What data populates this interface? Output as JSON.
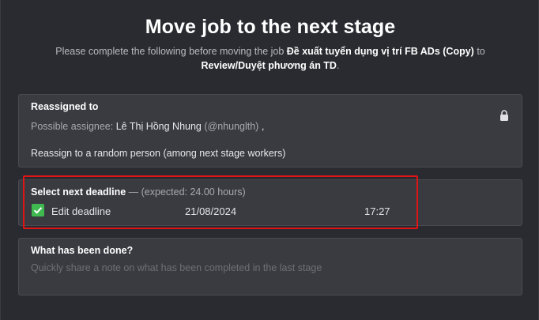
{
  "dialog": {
    "title": "Move job to the next stage",
    "subtitle_prefix": "Please complete the following before moving the job ",
    "job_name": "Đề xuất tuyển dụng vị trí FB ADs (Copy)",
    "subtitle_mid": " to ",
    "stage_name": "Review/Duyệt phương án TD",
    "subtitle_suffix": "."
  },
  "reassign": {
    "title": "Reassigned to",
    "possible_label": "Possible assignee: ",
    "assignee_name": "Lê Thị Hồng Nhung",
    "assignee_handle": " (@nhunglth)",
    "separator": "  ,",
    "random_option": "Reassign to a random person (among next stage workers)",
    "lock_icon": "lock-icon"
  },
  "deadline": {
    "title": "Select next deadline",
    "expected": " — (expected: 24.00 hours)",
    "edit_label": "Edit deadline",
    "edit_checked": true,
    "date": "21/08/2024",
    "time": "17:27",
    "check_color": "#3fb950",
    "highlight_color": "#e01414"
  },
  "done": {
    "title": "What has been done?",
    "placeholder": "Quickly share a note on what has been completed in the last stage"
  }
}
